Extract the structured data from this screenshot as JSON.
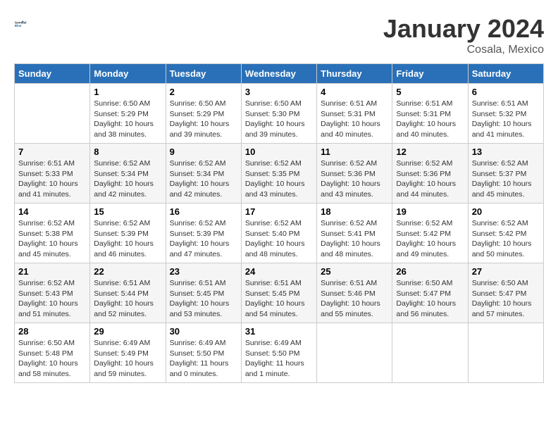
{
  "logo": {
    "line1": "General",
    "line2": "Blue"
  },
  "title": "January 2024",
  "subtitle": "Cosala, Mexico",
  "days_of_week": [
    "Sunday",
    "Monday",
    "Tuesday",
    "Wednesday",
    "Thursday",
    "Friday",
    "Saturday"
  ],
  "weeks": [
    [
      {
        "day": "",
        "info": ""
      },
      {
        "day": "1",
        "info": "Sunrise: 6:50 AM\nSunset: 5:29 PM\nDaylight: 10 hours\nand 38 minutes."
      },
      {
        "day": "2",
        "info": "Sunrise: 6:50 AM\nSunset: 5:29 PM\nDaylight: 10 hours\nand 39 minutes."
      },
      {
        "day": "3",
        "info": "Sunrise: 6:50 AM\nSunset: 5:30 PM\nDaylight: 10 hours\nand 39 minutes."
      },
      {
        "day": "4",
        "info": "Sunrise: 6:51 AM\nSunset: 5:31 PM\nDaylight: 10 hours\nand 40 minutes."
      },
      {
        "day": "5",
        "info": "Sunrise: 6:51 AM\nSunset: 5:31 PM\nDaylight: 10 hours\nand 40 minutes."
      },
      {
        "day": "6",
        "info": "Sunrise: 6:51 AM\nSunset: 5:32 PM\nDaylight: 10 hours\nand 41 minutes."
      }
    ],
    [
      {
        "day": "7",
        "info": "Sunrise: 6:51 AM\nSunset: 5:33 PM\nDaylight: 10 hours\nand 41 minutes."
      },
      {
        "day": "8",
        "info": "Sunrise: 6:52 AM\nSunset: 5:34 PM\nDaylight: 10 hours\nand 42 minutes."
      },
      {
        "day": "9",
        "info": "Sunrise: 6:52 AM\nSunset: 5:34 PM\nDaylight: 10 hours\nand 42 minutes."
      },
      {
        "day": "10",
        "info": "Sunrise: 6:52 AM\nSunset: 5:35 PM\nDaylight: 10 hours\nand 43 minutes."
      },
      {
        "day": "11",
        "info": "Sunrise: 6:52 AM\nSunset: 5:36 PM\nDaylight: 10 hours\nand 43 minutes."
      },
      {
        "day": "12",
        "info": "Sunrise: 6:52 AM\nSunset: 5:36 PM\nDaylight: 10 hours\nand 44 minutes."
      },
      {
        "day": "13",
        "info": "Sunrise: 6:52 AM\nSunset: 5:37 PM\nDaylight: 10 hours\nand 45 minutes."
      }
    ],
    [
      {
        "day": "14",
        "info": "Sunrise: 6:52 AM\nSunset: 5:38 PM\nDaylight: 10 hours\nand 45 minutes."
      },
      {
        "day": "15",
        "info": "Sunrise: 6:52 AM\nSunset: 5:39 PM\nDaylight: 10 hours\nand 46 minutes."
      },
      {
        "day": "16",
        "info": "Sunrise: 6:52 AM\nSunset: 5:39 PM\nDaylight: 10 hours\nand 47 minutes."
      },
      {
        "day": "17",
        "info": "Sunrise: 6:52 AM\nSunset: 5:40 PM\nDaylight: 10 hours\nand 48 minutes."
      },
      {
        "day": "18",
        "info": "Sunrise: 6:52 AM\nSunset: 5:41 PM\nDaylight: 10 hours\nand 48 minutes."
      },
      {
        "day": "19",
        "info": "Sunrise: 6:52 AM\nSunset: 5:42 PM\nDaylight: 10 hours\nand 49 minutes."
      },
      {
        "day": "20",
        "info": "Sunrise: 6:52 AM\nSunset: 5:42 PM\nDaylight: 10 hours\nand 50 minutes."
      }
    ],
    [
      {
        "day": "21",
        "info": "Sunrise: 6:52 AM\nSunset: 5:43 PM\nDaylight: 10 hours\nand 51 minutes."
      },
      {
        "day": "22",
        "info": "Sunrise: 6:51 AM\nSunset: 5:44 PM\nDaylight: 10 hours\nand 52 minutes."
      },
      {
        "day": "23",
        "info": "Sunrise: 6:51 AM\nSunset: 5:45 PM\nDaylight: 10 hours\nand 53 minutes."
      },
      {
        "day": "24",
        "info": "Sunrise: 6:51 AM\nSunset: 5:45 PM\nDaylight: 10 hours\nand 54 minutes."
      },
      {
        "day": "25",
        "info": "Sunrise: 6:51 AM\nSunset: 5:46 PM\nDaylight: 10 hours\nand 55 minutes."
      },
      {
        "day": "26",
        "info": "Sunrise: 6:50 AM\nSunset: 5:47 PM\nDaylight: 10 hours\nand 56 minutes."
      },
      {
        "day": "27",
        "info": "Sunrise: 6:50 AM\nSunset: 5:47 PM\nDaylight: 10 hours\nand 57 minutes."
      }
    ],
    [
      {
        "day": "28",
        "info": "Sunrise: 6:50 AM\nSunset: 5:48 PM\nDaylight: 10 hours\nand 58 minutes."
      },
      {
        "day": "29",
        "info": "Sunrise: 6:49 AM\nSunset: 5:49 PM\nDaylight: 10 hours\nand 59 minutes."
      },
      {
        "day": "30",
        "info": "Sunrise: 6:49 AM\nSunset: 5:50 PM\nDaylight: 11 hours\nand 0 minutes."
      },
      {
        "day": "31",
        "info": "Sunrise: 6:49 AM\nSunset: 5:50 PM\nDaylight: 11 hours\nand 1 minute."
      },
      {
        "day": "",
        "info": ""
      },
      {
        "day": "",
        "info": ""
      },
      {
        "day": "",
        "info": ""
      }
    ]
  ]
}
